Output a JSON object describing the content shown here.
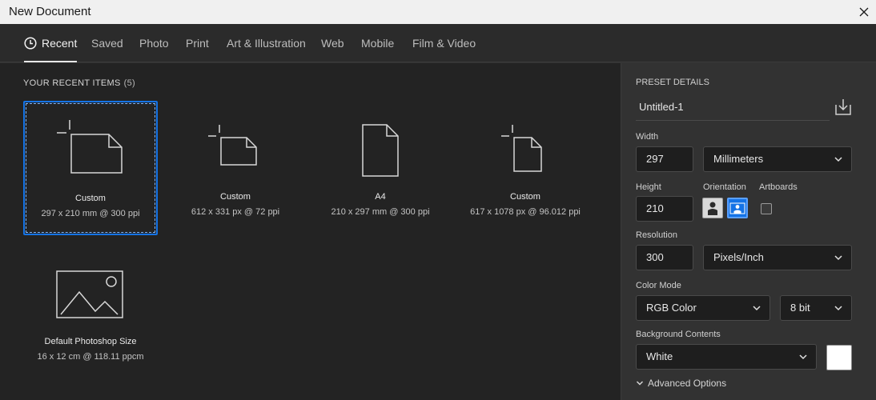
{
  "window": {
    "title": "New Document"
  },
  "tabs": [
    {
      "label": "Recent"
    },
    {
      "label": "Saved"
    },
    {
      "label": "Photo"
    },
    {
      "label": "Print"
    },
    {
      "label": "Art & Illustration"
    },
    {
      "label": "Web"
    },
    {
      "label": "Mobile"
    },
    {
      "label": "Film & Video"
    }
  ],
  "recent": {
    "title": "YOUR RECENT ITEMS",
    "count": "(5)",
    "items": [
      {
        "name": "Custom",
        "desc": "297 x 210 mm @ 300 ppi",
        "icon": "landscape-doc-icon"
      },
      {
        "name": "Custom",
        "desc": "612 x 331 px @ 72 ppi",
        "icon": "landscape-doc-icon"
      },
      {
        "name": "A4",
        "desc": "210 x 297 mm @ 300 ppi",
        "icon": "portrait-doc-icon"
      },
      {
        "name": "Custom",
        "desc": "617 x 1078 px @ 96.012 ppi",
        "icon": "portrait-doc-icon"
      },
      {
        "name": "Default Photoshop Size",
        "desc": "16 x 12 cm @ 118.11 ppcm",
        "icon": "image-icon"
      }
    ]
  },
  "preset": {
    "heading": "PRESET DETAILS",
    "name": "Untitled-1",
    "width_label": "Width",
    "width_value": "297",
    "width_unit": "Millimeters",
    "height_label": "Height",
    "height_value": "210",
    "orientation_label": "Orientation",
    "artboards_label": "Artboards",
    "resolution_label": "Resolution",
    "resolution_value": "300",
    "resolution_unit": "Pixels/Inch",
    "color_mode_label": "Color Mode",
    "color_mode": "RGB Color",
    "bit_depth": "8 bit",
    "background_label": "Background Contents",
    "background": "White",
    "background_color": "#ffffff",
    "advanced": "Advanced Options"
  },
  "colors": {
    "accent": "#1473e6"
  }
}
